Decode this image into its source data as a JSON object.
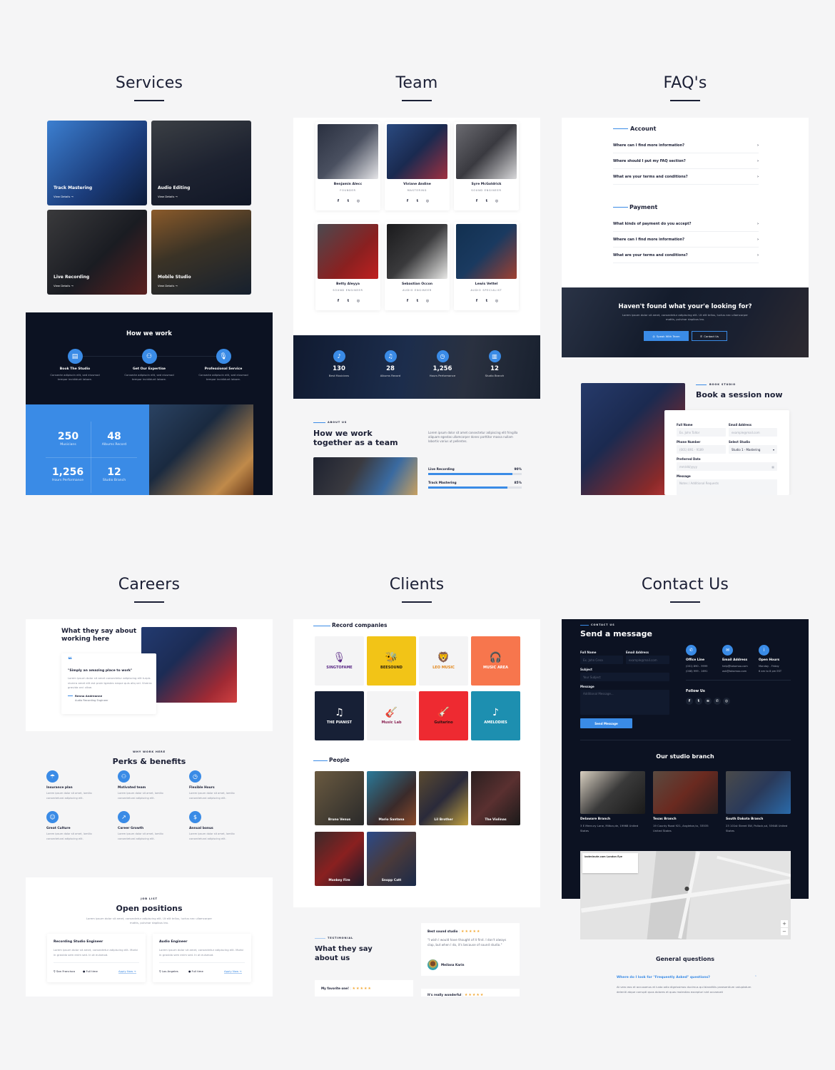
{
  "sections": {
    "services": "Services",
    "team": "Team",
    "faqs": "FAQ's",
    "careers": "Careers",
    "clients": "Clients",
    "contact": "Contact Us"
  },
  "services": {
    "cards": [
      {
        "title": "Track Mastering",
        "link": "View Details"
      },
      {
        "title": "Audio Editing",
        "link": "View Details"
      },
      {
        "title": "Live Recording",
        "link": "View Details"
      },
      {
        "title": "Mobile Studio",
        "link": "View Details"
      }
    ],
    "how_we_work": {
      "title": "How we work",
      "steps": [
        {
          "icon": "calendar-icon",
          "title": "Book The Studio",
          "text": "Consecte adipiscin elit, sed eiusmod tempor incididunt labore."
        },
        {
          "icon": "users-icon",
          "title": "Get Our Expertise",
          "text": "Consecte adipiscin elit, sed eiusmod tempor incididunt labore."
        },
        {
          "icon": "microphone-icon",
          "title": "Professional Service",
          "text": "Consecte adipiscin elit, sed eiusmod tempor incididunt labore."
        }
      ]
    },
    "stats": [
      {
        "value": "250",
        "label": "Musicians"
      },
      {
        "value": "48",
        "label": "Albums Record"
      },
      {
        "value": "1,256",
        "label": "Hours Performance"
      },
      {
        "value": "12",
        "label": "Studio Branch"
      }
    ]
  },
  "team": {
    "members": [
      {
        "name": "Benjamin Alecc",
        "role": "FOUNDER"
      },
      {
        "name": "Viviane Andine",
        "role": "MASTERING"
      },
      {
        "name": "Syre McGoldrick",
        "role": "SOUND ENGINEER"
      },
      {
        "name": "Betty Aleyya",
        "role": "SOUND ENGINEER"
      },
      {
        "name": "Sebastian Occon",
        "role": "AUDIO ENGINEER"
      },
      {
        "name": "Lewis Vettel",
        "role": "AUDIO SPECIALIST"
      }
    ],
    "social": [
      "facebook-icon",
      "twitter-icon",
      "instagram-icon"
    ],
    "stats": [
      {
        "value": "130",
        "label": "Best Musicians"
      },
      {
        "value": "28",
        "label": "Albums Record"
      },
      {
        "value": "1,256",
        "label": "Hours Performance"
      },
      {
        "value": "12",
        "label": "Studio Branch"
      }
    ],
    "about": {
      "eyebrow": "ABOUT US",
      "title_line1": "How we work",
      "title_line2": "together as a team",
      "text": "Lorem ipsum dolor sit amet consectetur adipiscing elit fringilla aliquam egestas ullamcorper donec porttitor massa nullam lobortis varius ut pellentes.",
      "skills": [
        {
          "label": "Live Recording",
          "percent": 90,
          "display": "90%"
        },
        {
          "label": "Track Mastering",
          "percent": 85,
          "display": "85%"
        }
      ]
    }
  },
  "faq": {
    "groups": [
      {
        "title": "Account",
        "questions": [
          "Where can I find more information?",
          "Where should I put my FAQ section?",
          "What are your terms and conditions?"
        ]
      },
      {
        "title": "Payment",
        "questions": [
          "What kinds of payment do you accept?",
          "Where can I find more information?",
          "What are your terms and conditions?"
        ]
      }
    ],
    "cta": {
      "title": "Haven't found what your'e looking for?",
      "text": "Lorem ipsum dolor sit amet, consectetur adipiscing elit. Ut elit tellus, luctus nec ullamcorper mattis, pulvinar dapibus leo.",
      "primary": "Speak With Team",
      "secondary": "Contact Us"
    },
    "booking": {
      "eyebrow": "BOOK STUDIO",
      "title": "Book a session now",
      "full_name_label": "Full Name",
      "full_name_placeholder": "Ex. John Toltor",
      "email_label": "Email Address",
      "email_placeholder": "example@mail.com",
      "phone_label": "Phone Number",
      "phone_placeholder": "(001) 891 - 9189",
      "studio_label": "Select Studio",
      "studio_value": "Studio 1 - Mastering",
      "date_label": "Preferred Date",
      "date_placeholder": "mm/dd/yyyy",
      "message_label": "Message",
      "message_placeholder": "Notes / Additional Requests"
    }
  },
  "careers": {
    "testimonial": {
      "title_line1": "What they say about",
      "title_line2": "working here",
      "quote": "\"Simply an amazing place to work\"",
      "text": "Lorem ipsum dolor sit amet consectetur adipiscing elit turpis viverra amet elit est proin tgestes neque quis aliq vel. Viverra gravida orci vitae.",
      "author": "Renna Andreanne",
      "author_role": "Audio Recording Engineer"
    },
    "perks": {
      "eyebrow": "WHY WORK HERE",
      "title": "Perks & benefits",
      "items": [
        {
          "icon": "umbrella-icon",
          "title": "Insurance plan",
          "text": "Lorem ipsum dolor sit amet, lomilio consectetural adipiscing elit."
        },
        {
          "icon": "team-icon",
          "title": "Motivated team",
          "text": "Lorem ipsum dolor sit amet, lomilio consectetural adipiscing elit."
        },
        {
          "icon": "clock-icon",
          "title": "Flexible Hours",
          "text": "Lorem ipsum dolor sit amet, lomilio consectetural adipiscing elit."
        },
        {
          "icon": "smile-icon",
          "title": "Great Culture",
          "text": "Lorem ipsum dolor sit amet, lomilio consectetural adipiscing elit."
        },
        {
          "icon": "growth-icon",
          "title": "Career Growth",
          "text": "Lorem ipsum dolor sit amet, lomilio consectetural adipiscing elit."
        },
        {
          "icon": "money-icon",
          "title": "Annual bonus",
          "text": "Lorem ipsum dolor sit amet, lomilio consectetural adipiscing elit."
        }
      ]
    },
    "jobs": {
      "eyebrow": "JOB LIST",
      "title": "Open positions",
      "text": "Lorem ipsum dolor sit amet, consectetur adipiscing elit. Ut elit tellus, luctus nec ullamcorper mattis, pulvinar dapibus leo.",
      "items": [
        {
          "title": "Recording Studio Engineer",
          "text": "Lorem ipsum dolor sit amet, consectetur adipiscing elit. Morbi in gravida sem enim sed. In at euismod.",
          "location": "San Francisco",
          "type": "Full time",
          "apply": "Apply Now"
        },
        {
          "title": "Audio Engineer",
          "text": "Lorem ipsum dolor sit amet, consectetur adipiscing elit. Morbi in gravida sem enim sed. In at euismod.",
          "location": "Los Angeles",
          "type": "Full time",
          "apply": "Apply Now"
        }
      ]
    }
  },
  "clients": {
    "record_title": "Record companies",
    "logos": [
      {
        "name": "SINGTOFAME",
        "bg": "#f4f4f5",
        "fg": "#5b2a86"
      },
      {
        "name": "BEESOUND",
        "bg": "#f2c417",
        "fg": "#2a1f10"
      },
      {
        "name": "LEO MUSIC",
        "bg": "#f4f4f5",
        "fg": "#e2861a"
      },
      {
        "name": "MUSIC AREA",
        "bg": "#f7764d",
        "fg": "#ffffff"
      },
      {
        "name": "THE PIANIST",
        "bg": "#172036",
        "fg": "#ffffff"
      },
      {
        "name": "Music Lab",
        "bg": "#f4f4f5",
        "fg": "#8b2454"
      },
      {
        "name": "Guitarino",
        "bg": "#ee2a31",
        "fg": "#2a1011"
      },
      {
        "name": "AMELODIES",
        "bg": "#1d8fb0",
        "fg": "#ffffff"
      }
    ],
    "people_title": "People",
    "people": [
      "Bruno Venus",
      "Mario Santana",
      "Lil Brother",
      "The Violinas",
      "Monkey Fire",
      "Snopp Catt"
    ],
    "testimonial": {
      "eyebrow": "TESTIMONIAL",
      "title_line1": "What they say",
      "title_line2": "about us",
      "review1_title": "Best sound studio",
      "review1_text": "\"I wish I would have thought of it first. I don't always clap, but when I do, it's because of sound studio.\"",
      "review1_author": "Meilana Karin",
      "review2_title": "My favorite one!",
      "review3_title": "It's really wonderful",
      "stars": "★★★★★"
    }
  },
  "contact": {
    "eyebrow": "CONTACT US",
    "title": "Send a message",
    "full_name_label": "Full Name",
    "full_name_placeholder": "Ex. John Cena",
    "email_label": "Email Address",
    "email_placeholder": "example@mail.com",
    "subject_label": "Subject",
    "subject_placeholder": "Your Subject",
    "message_label": "Message",
    "message_placeholder": "Additional Message...",
    "send": "Send Message",
    "info": [
      {
        "icon": "phone-icon",
        "title": "Office Line",
        "line1": "(001) 890 - 9999",
        "line2": "(008) 999 - 1691"
      },
      {
        "icon": "mail-icon",
        "title": "Email Address",
        "line1": "help@tokomoo.com",
        "line2": "ask@tokomoo.com"
      },
      {
        "icon": "info-icon",
        "title": "Open Hours",
        "line1": "Monday - Friday",
        "line2": "6 am to 8 pm EST"
      }
    ],
    "follow": "Follow Us",
    "social": [
      "facebook-icon",
      "twitter-icon",
      "spotify-icon",
      "whatsapp-icon",
      "instagram-icon"
    ],
    "branch_title": "Our studio branch",
    "branches": [
      {
        "name": "Delaware Branch",
        "address": "3 E Mercury Lane, Milton,de, 19968 United States"
      },
      {
        "name": "Texas Branch",
        "address": "19 County Road 921, Angleton,tx, 33535 United States"
      },
      {
        "name": "South Dakota Branch",
        "address": "23 101st Street SW, Pollock,sd, 53648 United States"
      }
    ],
    "map_place": "lastminute.com London Eye",
    "map_zoom_in": "+",
    "map_zoom_out": "−",
    "general_title": "General questions",
    "general_q": "Where do I look for \"Frequently Asked\" questions?",
    "general_a": "At vero eos et accusamus et iusto odio dignissimos ducimus qui blanditiis praesentium voluptatum deleniti atque corrupti quos dolores et quas molestias excepturi sint occaecati"
  }
}
